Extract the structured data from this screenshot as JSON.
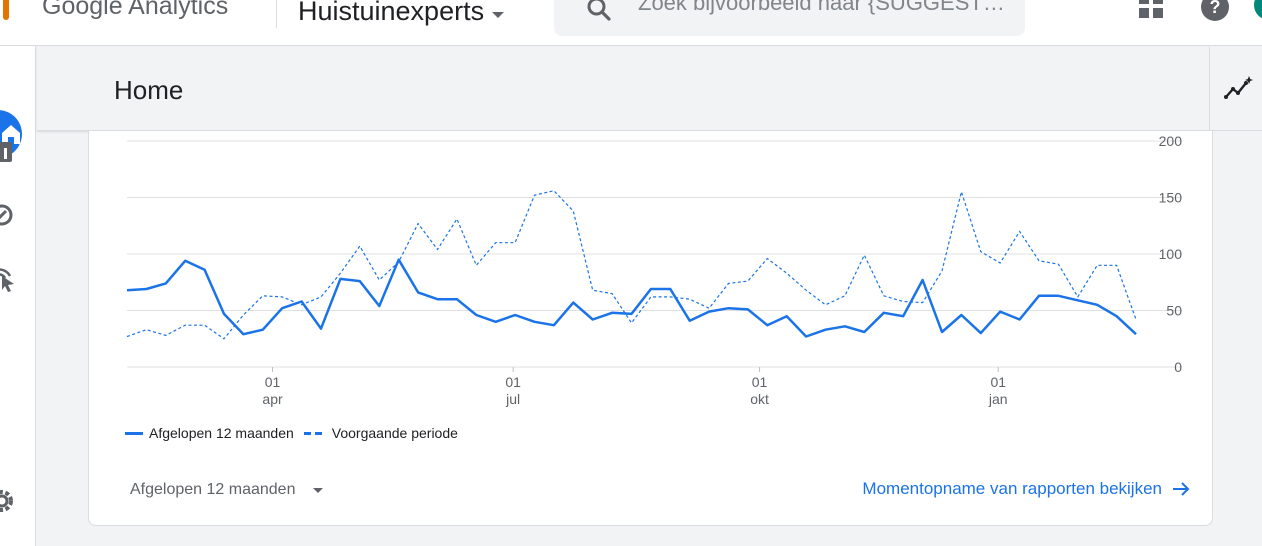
{
  "header": {
    "app_title": "Google Analytics",
    "property_name": "Huistuinexperts",
    "search_placeholder": "Zoek bijvoorbeeld naar {SUGGESTED...",
    "icons": [
      "analytics-logo-icon",
      "search-icon",
      "apps-grid-icon",
      "help-icon",
      "account-avatar"
    ]
  },
  "sidebar": {
    "items": [
      {
        "name": "home",
        "icon": "home-icon",
        "active": true
      },
      {
        "name": "reports",
        "icon": "bar-chart-icon"
      },
      {
        "name": "explore",
        "icon": "explore-icon"
      },
      {
        "name": "advertising",
        "icon": "ads-target-icon"
      },
      {
        "name": "admin",
        "icon": "gear-icon"
      }
    ]
  },
  "page": {
    "title": "Home",
    "insights_icon": "insights-sparkle-icon"
  },
  "card": {
    "legend_current": "Afgelopen 12 maanden",
    "legend_previous": "Voorgaande periode",
    "period_select": "Afgelopen 12 maanden",
    "snapshot_link": "Momentopname van rapporten bekijken"
  },
  "colors": {
    "accent": "#1a73e8",
    "text": "#202124",
    "muted": "#5f6368",
    "grid": "#e0e0e0"
  },
  "chart_data": {
    "type": "line",
    "ylim": [
      0,
      200
    ],
    "y_ticks": [
      200,
      150,
      100,
      50,
      0
    ],
    "x_ticks": [
      {
        "day": "01",
        "month": "apr",
        "index": 7.5
      },
      {
        "day": "01",
        "month": "jul",
        "index": 19.9
      },
      {
        "day": "01",
        "month": "okt",
        "index": 32.6
      },
      {
        "day": "01",
        "month": "jan",
        "index": 44.9
      }
    ],
    "series": [
      {
        "name": "Afgelopen 12 maanden",
        "style": "solid",
        "values": [
          68,
          69,
          74,
          94,
          86,
          47,
          29,
          33,
          52,
          58,
          34,
          78,
          76,
          54,
          95,
          66,
          60,
          60,
          46,
          40,
          46,
          40,
          37,
          57,
          42,
          48,
          47,
          69,
          69,
          41,
          49,
          52,
          51,
          37,
          45,
          27,
          33,
          36,
          31,
          48,
          45,
          77,
          31,
          46,
          30,
          49,
          42,
          63,
          63,
          59,
          55,
          45,
          29
        ]
      },
      {
        "name": "Voorgaande periode",
        "style": "dashed",
        "values": [
          27,
          33,
          28,
          37,
          37,
          25,
          46,
          63,
          62,
          55,
          62,
          83,
          107,
          77,
          93,
          127,
          104,
          131,
          90,
          110,
          110,
          152,
          156,
          138,
          68,
          65,
          39,
          62,
          62,
          60,
          52,
          74,
          76,
          96,
          83,
          68,
          55,
          63,
          99,
          63,
          58,
          57,
          85,
          155,
          102,
          92,
          120,
          94,
          91,
          62,
          90,
          90,
          42
        ]
      }
    ]
  }
}
